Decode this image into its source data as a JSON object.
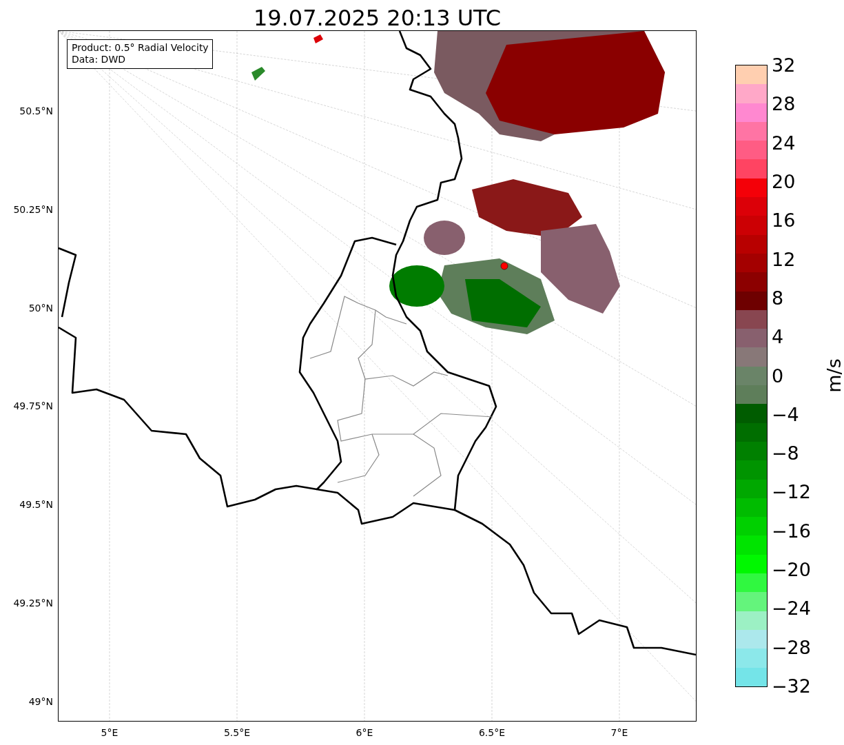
{
  "title": "19.07.2025 20:13 UTC",
  "map": {
    "info_box": [
      "Product: 0.5° Radial Velocity",
      "Data: DWD"
    ],
    "xticks": [
      "5°E",
      "5.5°E",
      "6°E",
      "6.5°E",
      "7°E"
    ],
    "yticks": [
      "50.5°N",
      "50.25°N",
      "50°N",
      "49.75°N",
      "49.5°N",
      "49.25°N",
      "49°N"
    ]
  },
  "colorbar": {
    "label": "m/s",
    "ticks": [
      "32",
      "28",
      "24",
      "20",
      "16",
      "12",
      "8",
      "4",
      "0",
      "−4",
      "−8",
      "−12",
      "−16",
      "−20",
      "−24",
      "−28",
      "−32"
    ],
    "bands": [
      {
        "color": "#ffcfb0"
      },
      {
        "color": "#ffa8c8"
      },
      {
        "color": "#ff88d0"
      },
      {
        "color": "#ff74a4"
      },
      {
        "color": "#ff5c84"
      },
      {
        "color": "#ff4462"
      },
      {
        "color": "#f40008"
      },
      {
        "color": "#dc0008"
      },
      {
        "color": "#cc0004"
      },
      {
        "color": "#b80000"
      },
      {
        "color": "#a40000"
      },
      {
        "color": "#8c0000"
      },
      {
        "color": "#6e0000"
      },
      {
        "color": "#884650"
      },
      {
        "color": "#88606e"
      },
      {
        "color": "#887878"
      },
      {
        "color": "#6a8468"
      },
      {
        "color": "#5e7e5a"
      },
      {
        "color": "#005c00"
      },
      {
        "color": "#006e00"
      },
      {
        "color": "#008000"
      },
      {
        "color": "#009400"
      },
      {
        "color": "#00a800"
      },
      {
        "color": "#00bc00"
      },
      {
        "color": "#00d000"
      },
      {
        "color": "#00e400"
      },
      {
        "color": "#00f800"
      },
      {
        "color": "#30f840"
      },
      {
        "color": "#64f47c"
      },
      {
        "color": "#9cf0c4"
      },
      {
        "color": "#ace8ec"
      },
      {
        "color": "#8ce8ea"
      },
      {
        "color": "#74e4e8"
      }
    ]
  }
}
